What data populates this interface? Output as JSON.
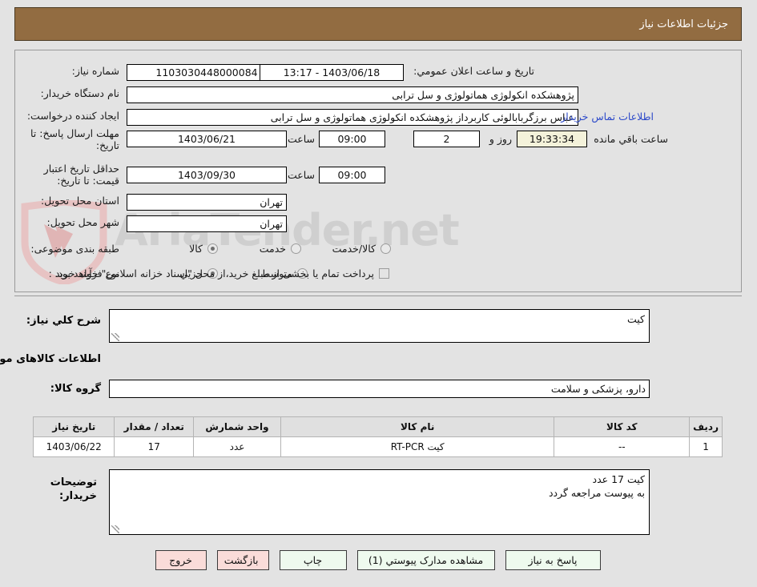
{
  "header": {
    "title": "جزئیات اطلاعات نیاز",
    "bar_color": "#926c41"
  },
  "watermark": {
    "text": "AriaTender.net",
    "logo": "shield-logo"
  },
  "form": {
    "need_number": {
      "label": "شماره نیاز:",
      "value": "1103030448000084"
    },
    "public_announce": {
      "label": "تاریخ و ساعت اعلان عمومي:",
      "value": "1403/06/18 - 13:17"
    },
    "buyer_org": {
      "label": "نام دستگاه خریدار:",
      "value": "پژوهشکده انکولوژی هماتولوژی و سل ترابی"
    },
    "request_creator": {
      "label": "ایجاد کننده درخواست:",
      "value": "عباس برزگربابالوئی کاربرداز پژوهشکده انکولوژی هماتولوژی و سل ترابی"
    },
    "contact_link": "اطلاعات تماس خریدار",
    "response_deadline": {
      "label": "مهلت ارسال پاسخ: تا تاریخ:",
      "date": "1403/06/21",
      "time_label": "ساعت",
      "time": "09:00",
      "days": "2",
      "days_label": "روز و",
      "countdown": "19:33:34",
      "countdown_suffix": "ساعت باقي مانده"
    },
    "price_validity": {
      "label": "حداقل تاریخ اعتبار قیمت: تا تاریخ:",
      "date": "1403/09/30",
      "time_label": "ساعت",
      "time": "09:00"
    },
    "delivery_province": {
      "label": "استان محل تحویل:",
      "value": "تهران"
    },
    "delivery_city": {
      "label": "شهر محل تحویل:",
      "value": "تهران"
    },
    "subject_class": {
      "label": "طبقه بندی موضوعی:",
      "options": [
        "کالا",
        "خدمت",
        "کالا/خدمت"
      ],
      "selected": "کالا"
    },
    "purchase_process": {
      "label": "نوع فرآیند خرید :",
      "options": [
        "جزیي",
        "متوسط"
      ],
      "selected": "جزیي"
    },
    "treasury_note": {
      "text": "پرداخت تمام یا بخشی از مبلغ خرید،از محل \"اسناد خزانه اسلامی\" خواهد بود.",
      "checked": false
    }
  },
  "sections": {
    "general_desc": {
      "label": "شرح کلي نیاز:",
      "value": "کیت"
    },
    "goods_info_title": "اطلاعات کالاهای مورد نیاز",
    "goods_group": {
      "label": "گروه کالا:",
      "value": "دارو، پزشکی و سلامت"
    },
    "buyer_notes": {
      "label": "توضیحات خریدار:",
      "lines": [
        "کیت                  17 عدد",
        "به پیوست مراجعه گردد"
      ]
    }
  },
  "table": {
    "headers": [
      "ردیف",
      "کد کالا",
      "نام کالا",
      "واحد شمارش",
      "تعداد / مقدار",
      "تاریخ نیاز"
    ],
    "rows": [
      {
        "index": "1",
        "code": "--",
        "name": "کیت RT-PCR",
        "unit": "عدد",
        "qty": "17",
        "need_date": "1403/06/22"
      }
    ]
  },
  "buttons": [
    {
      "label": "پاسخ به نیاز",
      "style": "green"
    },
    {
      "label": "مشاهده مدارک پیوستي (1)",
      "style": "green"
    },
    {
      "label": "چاپ",
      "style": "green"
    },
    {
      "label": "بازگشت",
      "style": "pink"
    },
    {
      "label": "خروج",
      "style": "pink"
    }
  ]
}
